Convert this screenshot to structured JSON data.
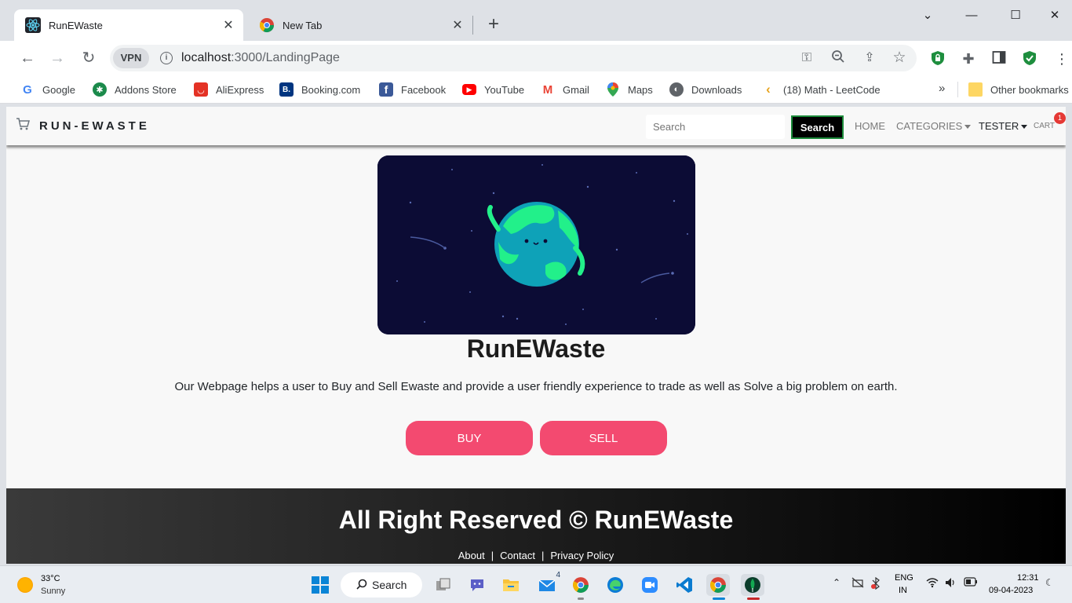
{
  "browser": {
    "tabs": [
      {
        "title": "RunEWaste",
        "close": "✕"
      },
      {
        "title": "New Tab",
        "close": "✕"
      }
    ],
    "new_tab": "+",
    "window_controls": {
      "dropdown": "⌄",
      "minimize": "—",
      "maximize": "☐",
      "close": "✕"
    },
    "nav": {
      "back": "←",
      "forward": "→",
      "reload": "↻"
    },
    "vpn_label": "VPN",
    "url_host": "localhost",
    "url_path": ":3000/LandingPage",
    "bookmarks": [
      {
        "label": "Google",
        "icon": "google-icon",
        "color": "#4285f4",
        "glyph": "G"
      },
      {
        "label": "Addons Store",
        "icon": "addons-icon",
        "color": "#1b8a4b",
        "glyph": "✱"
      },
      {
        "label": "AliExpress",
        "icon": "aliexpress-icon",
        "color": "#e43225",
        "glyph": "◡"
      },
      {
        "label": "Booking.com",
        "icon": "booking-icon",
        "color": "#003580",
        "glyph": "B."
      },
      {
        "label": "Facebook",
        "icon": "facebook-icon",
        "color": "#3b5998",
        "glyph": "f"
      },
      {
        "label": "YouTube",
        "icon": "youtube-icon",
        "color": "#ff0000",
        "glyph": "▶"
      },
      {
        "label": "Gmail",
        "icon": "gmail-icon",
        "color": "#ffffff",
        "glyph": "M"
      },
      {
        "label": "Maps",
        "icon": "maps-icon",
        "color": "#ffffff",
        "glyph": "📍"
      },
      {
        "label": "Downloads",
        "icon": "downloads-icon",
        "color": "#5f6368",
        "glyph": "◐"
      },
      {
        "label": "(18) Math - LeetCode",
        "icon": "leetcode-icon",
        "color": "#ffffff",
        "glyph": "‹"
      }
    ],
    "bookmarks_more": "»",
    "other_bookmarks": "Other bookmarks"
  },
  "site": {
    "brand": "RUN-EWASTE",
    "search_placeholder": "Search",
    "search_button": "Search",
    "nav": {
      "home": "HOME",
      "categories": "CATEGORIES",
      "user": "TESTER",
      "cart": "CART"
    },
    "cart_count": "1",
    "hero_title": "RunEWaste",
    "hero_description": "Our Webpage helps a user to Buy and Sell Ewaste and provide a user friendly experience to trade as well as Solve a big problem on earth.",
    "buy_button": "BUY",
    "sell_button": "SELL",
    "footer_title": "All Right Reserved © RunEWaste",
    "footer_links": [
      "About",
      "Contact",
      "Privacy Policy"
    ],
    "footer_separator": "|"
  },
  "taskbar": {
    "weather_temp": "33°C",
    "weather_condition": "Sunny",
    "search_label": "Search",
    "mail_badge": "4",
    "lang_primary": "ENG",
    "lang_secondary": "IN",
    "time": "12:31",
    "date": "09-04-2023"
  },
  "colors": {
    "accent_button": "#f34a70",
    "search_button_border": "#1b8b3a",
    "cart_badge": "#e53935"
  }
}
